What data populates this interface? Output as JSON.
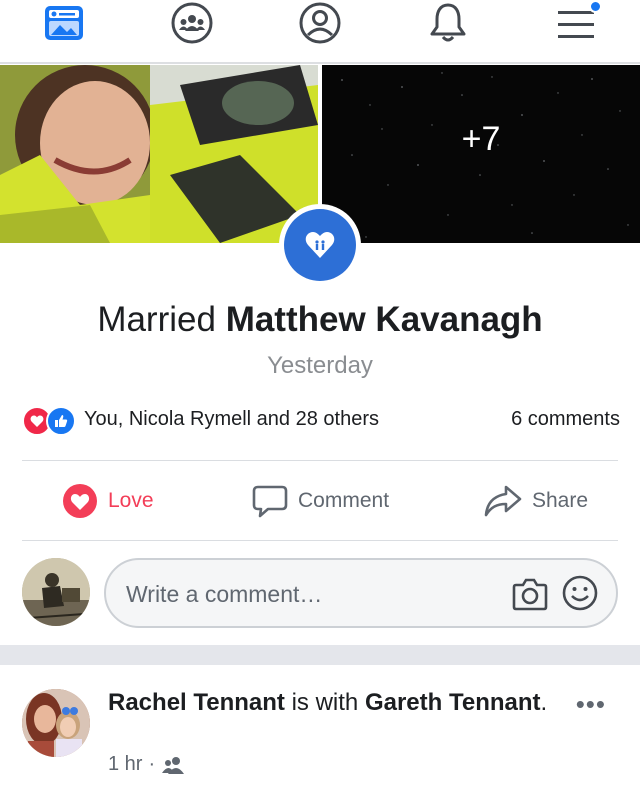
{
  "nav": {
    "items": [
      {
        "name": "news-feed-icon",
        "active": true
      },
      {
        "name": "groups-icon",
        "active": false
      },
      {
        "name": "profile-icon",
        "active": false
      },
      {
        "name": "notifications-icon",
        "active": false
      },
      {
        "name": "menu-icon",
        "active": false
      }
    ],
    "accent": "#1877f2"
  },
  "event": {
    "photos_more": "+7",
    "title_prefix": "Married",
    "title_name": "Matthew Kavanagh",
    "date": "Yesterday"
  },
  "reactions": {
    "text": "You, Nicola Rymell and 28 others",
    "comments": "6 comments"
  },
  "actions": {
    "love": "Love",
    "comment": "Comment",
    "share": "Share"
  },
  "comment_box": {
    "placeholder": "Write a comment…"
  },
  "next_post": {
    "author": "Rachel Tennant",
    "with_text": " is with ",
    "tagged": "Gareth Tennant",
    "end": ".",
    "time": "1 hr",
    "dot": "·",
    "more": "•••"
  },
  "colors": {
    "love": "#f33e58",
    "like": "#1877f2",
    "text": "#1c1e21",
    "muted": "#606770"
  }
}
